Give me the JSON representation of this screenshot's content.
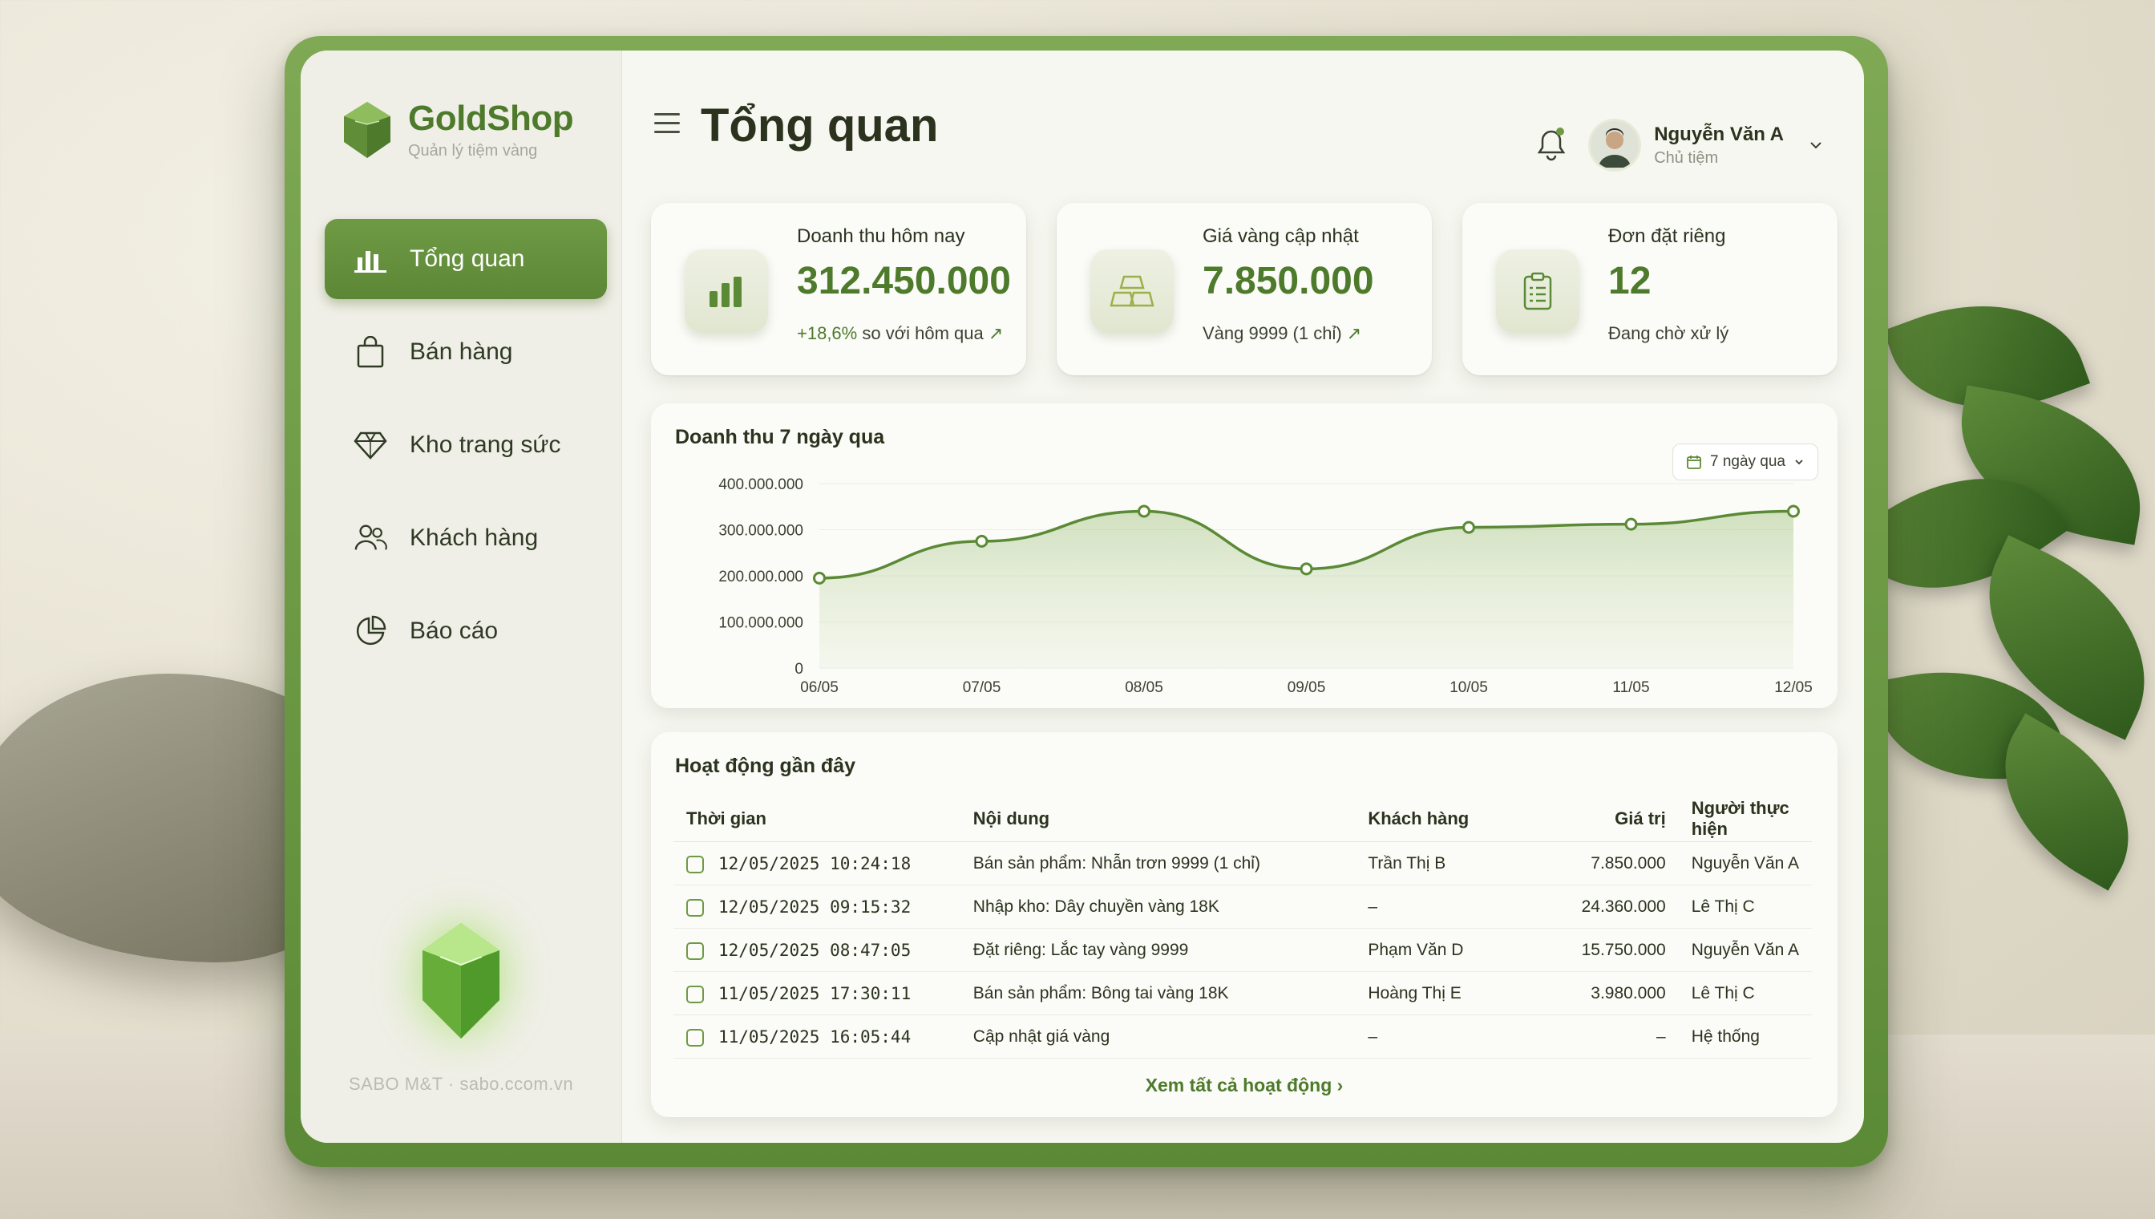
{
  "brand": {
    "name": "GoldShop",
    "subtitle": "Quản lý tiệm vàng"
  },
  "nav": [
    {
      "label": "Tổng quan",
      "icon": "bar-chart-icon",
      "active": true
    },
    {
      "label": "Bán hàng",
      "icon": "shopping-bag-icon",
      "active": false
    },
    {
      "label": "Kho trang sức",
      "icon": "diamond-icon",
      "active": false
    },
    {
      "label": "Khách hàng",
      "icon": "users-icon",
      "active": false
    },
    {
      "label": "Báo cáo",
      "icon": "pie-chart-icon",
      "active": false
    }
  ],
  "footer": "SABO M&T · sabo.ccom.vn",
  "header": {
    "title": "Tổng quan",
    "user_name": "Nguyễn Văn A",
    "user_role": "Chủ tiệm"
  },
  "cards": [
    {
      "label": "Doanh thu hôm nay",
      "value": "312.450.000",
      "sub_pos": "+18,6%",
      "sub": "so với hôm qua",
      "icon": "bar-chart-icon"
    },
    {
      "label": "Giá vàng cập nhật",
      "value": "7.850.000",
      "sub_pos": "",
      "sub": "Vàng 9999 (1 chỉ)",
      "icon": "gold-bars-icon"
    },
    {
      "label": "Đơn đặt riêng",
      "value": "12",
      "sub_pos": "",
      "sub": "Đang chờ xử lý",
      "icon": "clipboard-icon"
    }
  ],
  "chart": {
    "title": "Doanh thu 7 ngày qua",
    "range_label": "7 ngày qua"
  },
  "chart_data": {
    "type": "area",
    "title": "Doanh thu 7 ngày qua",
    "categories": [
      "06/05",
      "07/05",
      "08/05",
      "09/05",
      "10/05",
      "11/05",
      "12/05"
    ],
    "values": [
      195000000,
      275000000,
      340000000,
      215000000,
      305000000,
      312000000,
      340000000
    ],
    "ylim": [
      0,
      400000000
    ],
    "yticks": [
      {
        "value": 0,
        "label": "0"
      },
      {
        "value": 100000000,
        "label": "100.000.000"
      },
      {
        "value": 200000000,
        "label": "200.000.000"
      },
      {
        "value": 300000000,
        "label": "300.000.000"
      },
      {
        "value": 400000000,
        "label": "400.000.000"
      }
    ],
    "color": "#5b8a36"
  },
  "activity": {
    "title": "Hoạt động gần đây",
    "columns": [
      "Thời gian",
      "Nội dung",
      "Khách hàng",
      "Giá trị",
      "Người thực hiện"
    ],
    "rows": [
      [
        "12/05/2025 10:24:18",
        "Bán sản phẩm: Nhẫn trơn 9999 (1 chỉ)",
        "Trần Thị B",
        "7.850.000",
        "Nguyễn Văn A"
      ],
      [
        "12/05/2025 09:15:32",
        "Nhập kho: Dây chuyền vàng 18K",
        "–",
        "24.360.000",
        "Lê Thị C"
      ],
      [
        "12/05/2025 08:47:05",
        "Đặt riêng: Lắc tay vàng 9999",
        "Phạm Văn D",
        "15.750.000",
        "Nguyễn Văn A"
      ],
      [
        "11/05/2025 17:30:11",
        "Bán sản phẩm: Bông tai vàng 18K",
        "Hoàng Thị E",
        "3.980.000",
        "Lê Thị C"
      ],
      [
        "11/05/2025 16:05:44",
        "Cập nhật giá vàng",
        "–",
        "–",
        "Hệ thống"
      ]
    ],
    "view_all": "Xem tất cả hoạt động ›"
  },
  "colors": {
    "accent": "#5b8a36",
    "accent_light": "#6f9a45",
    "text": "#2b331f"
  }
}
